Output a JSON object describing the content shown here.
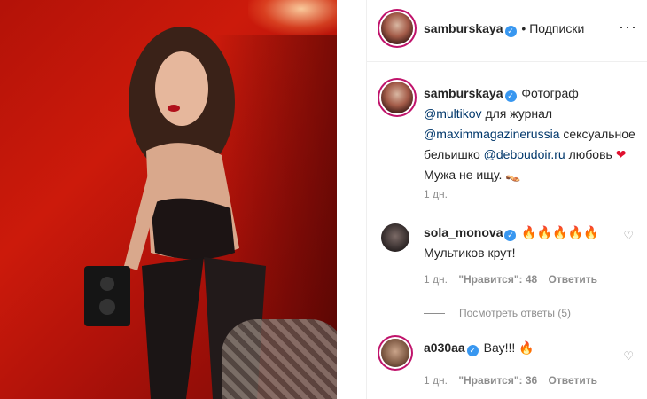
{
  "colors": {
    "link": "#00376b",
    "muted": "#8e8e8e",
    "verified": "#3897f0",
    "ring": "#c0136b"
  },
  "header": {
    "username": "samburskaya",
    "separator": "•",
    "follow_label": "Подписки",
    "more_label": "···"
  },
  "caption": {
    "username": "samburskaya",
    "text_1": "Фотограф ",
    "mention_1": "@multikov",
    "text_2": " для журнал ",
    "mention_2": "@maximmagazinerussia",
    "text_3": " сексуальное бельишко ",
    "mention_3": "@deboudoir.ru",
    "text_4": " любовь ",
    "heart": "❤",
    "text_5": " Мужа не ищу. ",
    "emoji_end": "👡",
    "time": "1 дн."
  },
  "comments": [
    {
      "username": "sola_monova",
      "emoji": "🔥🔥🔥🔥🔥",
      "text": "Мультиков крут!",
      "time": "1 дн.",
      "likes": "\"Нравится\": 48",
      "reply_label": "Ответить"
    },
    {
      "username": "a030aa",
      "emoji": "🔥",
      "text": "Вау!!!",
      "time": "1 дн.",
      "likes": "\"Нравится\": 36",
      "reply_label": "Ответить"
    }
  ],
  "view_replies_label": "Посмотреть ответы (5)",
  "like_icon": "♡"
}
